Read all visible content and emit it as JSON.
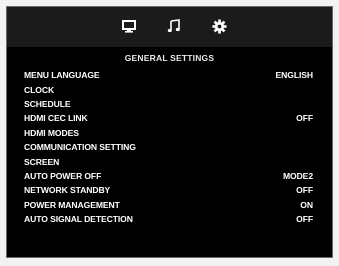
{
  "tabs": [
    {
      "icon": "monitor-icon",
      "selected": false
    },
    {
      "icon": "music-note-icon",
      "selected": false
    },
    {
      "icon": "gear-icon",
      "selected": true
    }
  ],
  "title": "GENERAL  SETTINGS",
  "items": [
    {
      "label": "MENU LANGUAGE",
      "value": "ENGLISH"
    },
    {
      "label": "CLOCK",
      "value": ""
    },
    {
      "label": "SCHEDULE",
      "value": ""
    },
    {
      "label": "HDMI CEC LINK",
      "value": "OFF"
    },
    {
      "label": "HDMI MODES",
      "value": ""
    },
    {
      "label": "COMMUNICATION SETTING",
      "value": ""
    },
    {
      "label": "SCREEN",
      "value": ""
    },
    {
      "label": "AUTO POWER OFF",
      "value": "MODE2"
    },
    {
      "label": "NETWORK STANDBY",
      "value": "OFF"
    },
    {
      "label": "POWER MANAGEMENT",
      "value": "ON"
    },
    {
      "label": "AUTO SIGNAL DETECTION",
      "value": "OFF"
    }
  ],
  "colors": {
    "osd_background": "#000000",
    "tab_bar": "#1b1b1b",
    "text": "#ffffff"
  }
}
